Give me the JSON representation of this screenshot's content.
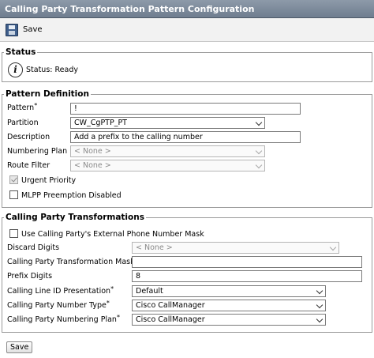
{
  "window": {
    "title": "Calling Party Transformation Pattern Configuration"
  },
  "toolbar": {
    "save_label": "Save",
    "save_icon": "save-icon"
  },
  "status": {
    "legend": "Status",
    "text": "Status: Ready",
    "icon": "info-icon"
  },
  "pattern_definition": {
    "legend": "Pattern Definition",
    "pattern": {
      "label": "Pattern",
      "required": "*",
      "value": "!"
    },
    "partition": {
      "label": "Partition",
      "value": "CW_CgPTP_PT"
    },
    "description": {
      "label": "Description",
      "value": "Add a prefix to the calling number"
    },
    "numbering_plan": {
      "label": "Numbering Plan",
      "value": "< None >"
    },
    "route_filter": {
      "label": "Route Filter",
      "value": "< None >"
    },
    "urgent_priority": {
      "label": "Urgent Priority",
      "checked": true,
      "disabled": true
    },
    "mlpp_preemption_disabled": {
      "label": "MLPP Preemption Disabled",
      "checked": false
    }
  },
  "calling_party_transformations": {
    "legend": "Calling Party Transformations",
    "use_external_mask": {
      "label": "Use Calling Party's External Phone Number Mask",
      "checked": false
    },
    "discard_digits": {
      "label": "Discard Digits",
      "value": "< None >"
    },
    "transformation_mask": {
      "label": "Calling Party Transformation Mask",
      "value": ""
    },
    "prefix_digits": {
      "label": "Prefix Digits",
      "value": "8"
    },
    "line_id_presentation": {
      "label": "Calling Line ID Presentation",
      "required": "*",
      "value": "Default"
    },
    "number_type": {
      "label": "Calling Party Number Type",
      "required": "*",
      "value": "Cisco CallManager"
    },
    "numbering_plan": {
      "label": "Calling Party Numbering Plan",
      "required": "*",
      "value": "Cisco CallManager"
    }
  },
  "footer": {
    "save_label": "Save"
  },
  "colors": {
    "titlebar": "#7b8898",
    "fieldset_border": "#9a9a9a"
  }
}
